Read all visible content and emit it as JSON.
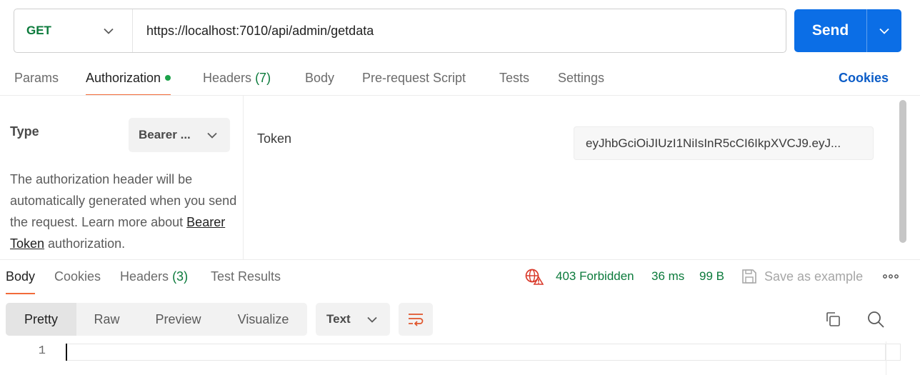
{
  "request": {
    "method": "GET",
    "url": "https://localhost:7010/api/admin/getdata",
    "send_label": "Send"
  },
  "request_tabs": {
    "params": "Params",
    "authorization": "Authorization",
    "headers": "Headers",
    "headers_count": "(7)",
    "body": "Body",
    "prerequest": "Pre-request Script",
    "tests": "Tests",
    "settings": "Settings",
    "cookies": "Cookies"
  },
  "auth": {
    "type_label": "Type",
    "type_value": "Bearer ...",
    "description_prefix": "The authorization header will be automatically generated when you send the request. Learn more about ",
    "link_text": "Bearer Token",
    "description_suffix": " authorization.",
    "token_label": "Token",
    "token_value": "eyJhbGciOiJIUzI1NiIsInR5cCI6IkpXVCJ9.eyJ..."
  },
  "response_tabs": {
    "body": "Body",
    "cookies": "Cookies",
    "headers": "Headers",
    "headers_count": "(3)",
    "test_results": "Test Results"
  },
  "response_status": {
    "status": "403 Forbidden",
    "time": "36 ms",
    "size": "99 B",
    "save_example": "Save as example"
  },
  "response_view": {
    "modes": [
      "Pretty",
      "Raw",
      "Preview",
      "Visualize"
    ],
    "active_mode": "Pretty",
    "format": "Text"
  },
  "editor": {
    "line_numbers": [
      "1"
    ]
  },
  "colors": {
    "accent_orange": "#f26b3a",
    "send_blue": "#0b6ee6",
    "status_green": "#0b7a3b",
    "link_blue": "#0b5cc7"
  }
}
